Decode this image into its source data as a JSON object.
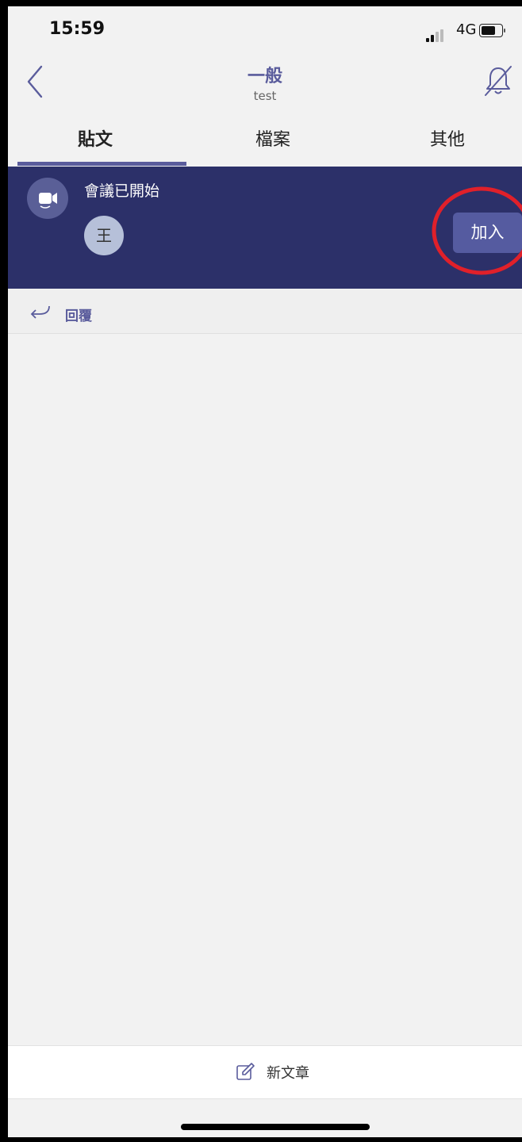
{
  "status_bar": {
    "time": "15:59",
    "network": "4G"
  },
  "header": {
    "title": "一般",
    "subtitle": "test",
    "back_icon": "chevron-left-icon",
    "notification_icon": "bell-off-icon"
  },
  "tabs": [
    {
      "label": "貼文",
      "active": true
    },
    {
      "label": "檔案",
      "active": false
    },
    {
      "label": "其他",
      "active": false
    }
  ],
  "meeting": {
    "title": "會議已開始",
    "participant_initial": "王",
    "join_label": "加入",
    "icon": "video-camera-icon",
    "highlight_color": "#e0202a"
  },
  "reply": {
    "label": "回覆",
    "icon": "reply-arrow-icon"
  },
  "compose": {
    "label": "新文章",
    "icon": "edit-icon"
  },
  "colors": {
    "accent": "#5a5c9c",
    "banner": "#2c3069",
    "join_button": "#555ba0",
    "background": "#f2f2f2"
  }
}
